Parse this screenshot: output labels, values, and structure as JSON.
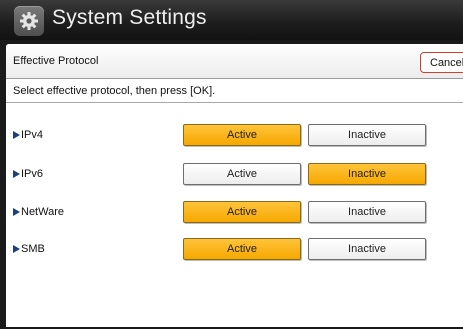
{
  "header": {
    "title": "System Settings",
    "icon": "gear-icon"
  },
  "subheader": {
    "label": "Effective Protocol",
    "cancel_label": "Cancel"
  },
  "instruction": "Select effective protocol, then press [OK].",
  "protocols": [
    {
      "name": "IPv4",
      "active_label": "Active",
      "inactive_label": "Inactive",
      "selected": "Active"
    },
    {
      "name": "IPv6",
      "active_label": "Active",
      "inactive_label": "Inactive",
      "selected": "Inactive"
    },
    {
      "name": "NetWare",
      "active_label": "Active",
      "inactive_label": "Inactive",
      "selected": "Active"
    },
    {
      "name": "SMB",
      "active_label": "Active",
      "inactive_label": "Inactive",
      "selected": "Active"
    }
  ],
  "colors": {
    "selected": "#f6a800",
    "cancel_border": "#c8422c",
    "arrow": "#1d3f7a"
  }
}
